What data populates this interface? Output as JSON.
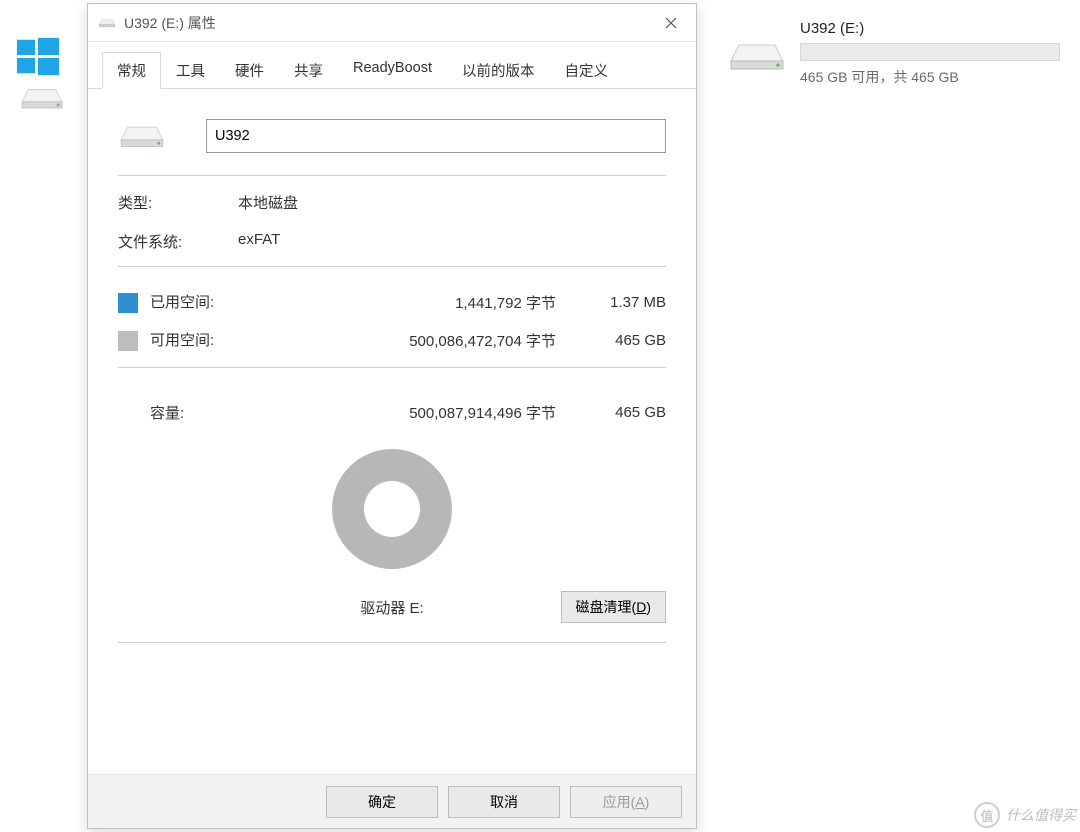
{
  "desktop": {
    "drive_caption": "U392 (E:)",
    "drive_sub": "465 GB 可用，共 465 GB"
  },
  "dialog": {
    "title": "U392 (E:) 属性",
    "tabs": [
      "常规",
      "工具",
      "硬件",
      "共享",
      "ReadyBoost",
      "以前的版本",
      "自定义"
    ],
    "active_tab_index": 0,
    "general": {
      "name_value": "U392",
      "type_label": "类型:",
      "type_value": "本地磁盘",
      "fs_label": "文件系统:",
      "fs_value": "exFAT",
      "used_label": "已用空间:",
      "used_bytes": "1,441,792 字节",
      "used_readable": "1.37 MB",
      "free_label": "可用空间:",
      "free_bytes": "500,086,472,704 字节",
      "free_readable": "465 GB",
      "capacity_label": "容量:",
      "capacity_bytes": "500,087,914,496 字节",
      "capacity_readable": "465 GB",
      "drive_letter_label": "驱动器 E:",
      "disk_cleanup_label": "磁盘清理(",
      "disk_cleanup_key": "D",
      "disk_cleanup_suffix": ")"
    },
    "buttons": {
      "ok": "确定",
      "cancel": "取消",
      "apply": "应用(",
      "apply_key": "A",
      "apply_suffix": ")"
    }
  },
  "watermark": {
    "badge": "值",
    "text": "什么值得买"
  },
  "colors": {
    "used": "#2f8fd3",
    "free": "#bdbdbd"
  }
}
